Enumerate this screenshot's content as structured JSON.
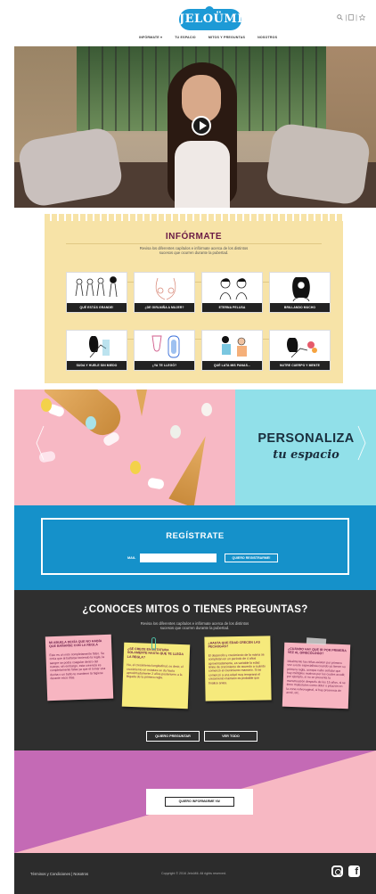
{
  "header": {
    "logo": "JELOÜMI",
    "icons": [
      "search-icon",
      "user-icon",
      "star-icon"
    ],
    "nav": [
      "INFÓRMATE ▾",
      "TU ESPACIO",
      "MITOS Y PREGUNTAS",
      "NOSOTROS"
    ]
  },
  "informate": {
    "title": "INFÓRMATE",
    "subtitle": "Revisa los diferentes capítulos e infórmate acerca de los distintos sucesos que ocurren durante la pubertad.",
    "cards": [
      "QUÉ ESTÁS GRANDE!",
      "¿DE GIRLNIÑA A MUJER?",
      "ETERNA PELUSA",
      "BRILLANDO MUCHO",
      "SUDA Y HUELE SIN MIEDO",
      "¿YA TE LLEGÓ?",
      "QUÉ LATA MIS PANAS...",
      "NUTRE CUERPO Y MENTE"
    ]
  },
  "personaliza": {
    "title": "PERSONALIZA",
    "subtitle": "tu espacio"
  },
  "registrate": {
    "title": "REGÍSTRATE",
    "mail_label": "MAIL",
    "input_placeholder": "",
    "button": "QUIERO REGISTRARME!"
  },
  "mitos": {
    "title": "¿CONOCES MITOS O TIENES PREGUNTAS?",
    "subtitle": "Revisa los diferentes capítulos e infórmate acerca de los distintos sucesos que ocurren durante la pubertad.",
    "notes": [
      {
        "title": "MI ABUELA DECÍA QUE NO HABÍA QUE BAÑARSE CON LA REGLA",
        "body": "Esto es un mito completamente falso. Se creía que al bañarse teniendo la regla, la sangre se podía coagular dentro del cuerpo, sin embargo, esta creencia es completamente falsa ya que el tomar una ducha o un baño te mantiene la higiene durante esos días."
      },
      {
        "title": "¿SE CRECE EN ESTATURA SOLAMENTE HASTA QUE TE LLEGA LA REGLA?",
        "body": "No, el crecimiento longitudinal, es decir, el crecimiento en estatura se da hasta aproximadamente 2 años posteriores a la llegada de la primera regla."
      },
      {
        "title": "¿HASTA QUE EDAD CRECEN LAS PECHUGAS?",
        "body": "El desarrollo y crecimiento de la mama se completan en un período de 4 años aproximadamente, es variable la edad límite de crecimiento de acuerdo a cuándo comenzó el crecimiento mamario. Si se comenzó a una edad muy temprana el crecimiento mamario es probable que finalice antes."
      },
      {
        "title": "¿CUÁNDO HAY QUE IR POR PRIMERA VEZ AL GINECÓLOGO?",
        "body": "Idealmente las niñas asisten por primera vez a este especialista cuando ya tienen su primera regla, aunque cabe señalar que hay múltiples motivos por los cuales acudir, por ejemplo, si no se presenta la menstruación después de los 15 años, si se tiene malestares como dolor o picazón en la zona vulvovaginal, si hay presencia de acné, etc."
      }
    ],
    "btn_ask": "QUIERO PREGUNTAR",
    "btn_all": "VER TODO"
  },
  "cta": {
    "button": "QUIERO INFORMARME YA!"
  },
  "footer": {
    "links": "Términos y Condiciones  |  Nosotros",
    "copyright": "Copyright © 2016 JeloüMi. All rights reserved.",
    "icons": [
      "instagram-icon",
      "facebook-icon"
    ]
  },
  "colors": {
    "blue": "#1591ca",
    "yellow": "#f7e3a7",
    "dark": "#2f2f2f",
    "pink": "#f7b8c4",
    "magenta": "#c46ab5",
    "cyan": "#91e0e9"
  }
}
